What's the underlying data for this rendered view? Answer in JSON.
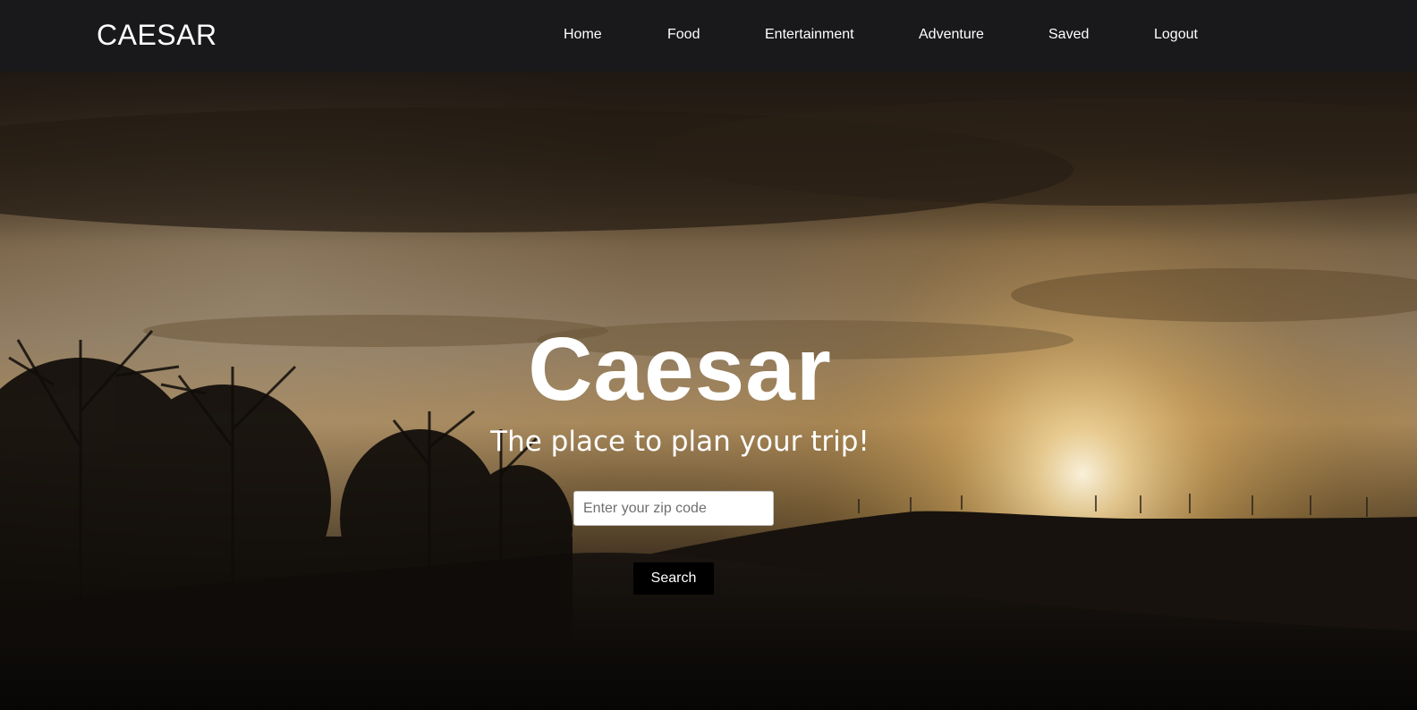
{
  "nav": {
    "brand": "CAESAR",
    "links": [
      {
        "label": "Home"
      },
      {
        "label": "Food"
      },
      {
        "label": "Entertainment"
      },
      {
        "label": "Adventure"
      },
      {
        "label": "Saved"
      },
      {
        "label": "Logout"
      }
    ]
  },
  "hero": {
    "title": "Caesar",
    "subtitle": "The place to plan your trip!",
    "zip_placeholder": "Enter your zip code",
    "zip_value": "",
    "search_label": "Search",
    "background": "sunset-landscape-photo"
  },
  "colors": {
    "navbar_bg": "#19181a",
    "button_bg": "#000000",
    "text": "#ffffff"
  }
}
